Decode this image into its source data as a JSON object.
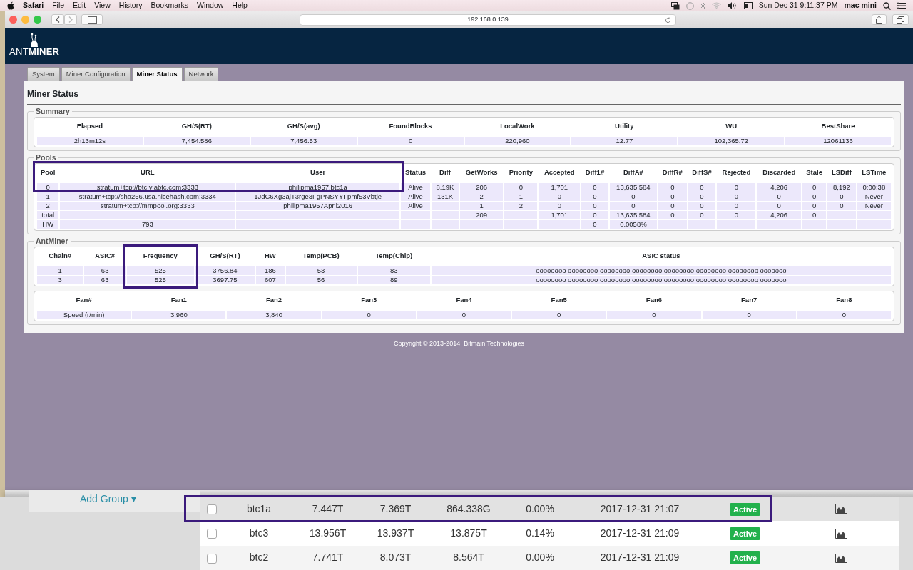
{
  "menu_bar": {
    "app": "Safari",
    "menus": [
      "File",
      "Edit",
      "View",
      "History",
      "Bookmarks",
      "Window",
      "Help"
    ],
    "clock": "Sun Dec 31  9:11:37 PM",
    "user": "mac mini"
  },
  "browser": {
    "url": "192.168.0.139"
  },
  "header": {
    "logo_light": "ANT",
    "logo_bold": "MINER"
  },
  "tabs": [
    {
      "label": "System",
      "selected": false
    },
    {
      "label": "Miner Configuration",
      "selected": false
    },
    {
      "label": "Miner Status",
      "selected": true
    },
    {
      "label": "Network",
      "selected": false
    }
  ],
  "page_title": "Miner Status",
  "summary": {
    "legend": "Summary",
    "columns": [
      "Elapsed",
      "GH/S(RT)",
      "GH/S(avg)",
      "FoundBlocks",
      "LocalWork",
      "Utility",
      "WU",
      "BestShare"
    ],
    "rows": [
      [
        "2h13m12s",
        "7,454.586",
        "7,456.53",
        "0",
        "220,960",
        "12.77",
        "102,365.72",
        "12061136"
      ]
    ]
  },
  "pools": {
    "legend": "Pools",
    "columns": [
      {
        "label": "Pool",
        "highlighted": true
      },
      {
        "label": "URL",
        "highlighted": true
      },
      {
        "label": "User",
        "highlighted": true
      },
      {
        "label": "Status",
        "highlighted": false
      },
      {
        "label": "Diff",
        "highlighted": false
      },
      {
        "label": "GetWorks",
        "highlighted": false
      },
      {
        "label": "Priority",
        "highlighted": false
      },
      {
        "label": "Accepted",
        "highlighted": false
      },
      {
        "label": "Diff1#",
        "highlighted": false
      },
      {
        "label": "DiffA#",
        "highlighted": false
      },
      {
        "label": "DiffR#",
        "highlighted": false
      },
      {
        "label": "DiffS#",
        "highlighted": false
      },
      {
        "label": "Rejected",
        "highlighted": false
      },
      {
        "label": "Discarded",
        "highlighted": false
      },
      {
        "label": "Stale",
        "highlighted": false
      },
      {
        "label": "LSDiff",
        "highlighted": false
      },
      {
        "label": "LSTime",
        "highlighted": false
      }
    ],
    "rows": [
      {
        "highlighted": true,
        "cells": [
          "0",
          "stratum+tcp://btc.viabtc.com:3333",
          "philipma1957.btc1a",
          "Alive",
          "8.19K",
          "206",
          "0",
          "1,701",
          "0",
          "13,635,584",
          "0",
          "0",
          "0",
          "4,206",
          "0",
          "8,192",
          "0:00:38"
        ]
      },
      {
        "highlighted": false,
        "cells": [
          "1",
          "stratum+tcp://sha256.usa.nicehash.com:3334",
          "1JdC6Xg3ajT3rge3FgPNSYYFpmf53Vbtje",
          "Alive",
          "131K",
          "2",
          "1",
          "0",
          "0",
          "0",
          "0",
          "0",
          "0",
          "0",
          "0",
          "0",
          "Never"
        ]
      },
      {
        "highlighted": false,
        "cells": [
          "2",
          "stratum+tcp://mmpool.org:3333",
          "philipma1957April2016",
          "Alive",
          null,
          "1",
          "2",
          "0",
          "0",
          "0",
          "0",
          "0",
          "0",
          "0",
          "0",
          "0",
          "Never"
        ]
      },
      {
        "highlighted": false,
        "cells": [
          "total",
          null,
          null,
          null,
          null,
          "209",
          null,
          "1,701",
          "0",
          "13,635,584",
          "0",
          "0",
          "0",
          "4,206",
          "0",
          null,
          null
        ]
      },
      {
        "highlighted": false,
        "cells": [
          "HW",
          "793",
          null,
          null,
          null,
          null,
          null,
          null,
          "0",
          "0.0058%",
          null,
          null,
          null,
          null,
          null,
          null,
          null
        ]
      }
    ]
  },
  "antminer": {
    "legend": "AntMiner",
    "chains": {
      "columns": [
        {
          "label": "Chain#",
          "highlighted": false
        },
        {
          "label": "ASIC#",
          "highlighted": false
        },
        {
          "label": "Frequency",
          "highlighted": true
        },
        {
          "label": "GH/S(RT)",
          "highlighted": false
        },
        {
          "label": "HW",
          "highlighted": false
        },
        {
          "label": "Temp(PCB)",
          "highlighted": false
        },
        {
          "label": "Temp(Chip)",
          "highlighted": false
        },
        {
          "label": "ASIC status",
          "highlighted": false
        }
      ],
      "rows": [
        {
          "highlighted": false,
          "cells": [
            "1",
            "63",
            "525",
            "3756.84",
            "186",
            "53",
            "83",
            "oooooooo oooooooo oooooooo oooooooo oooooooo oooooooo oooooooo ooooooo"
          ]
        },
        {
          "highlighted": false,
          "cells": [
            "3",
            "63",
            "525",
            "3697.75",
            "607",
            "56",
            "89",
            "oooooooo oooooooo oooooooo oooooooo oooooooo oooooooo oooooooo ooooooo"
          ]
        }
      ]
    },
    "fans": {
      "columns": [
        "Fan#",
        "Fan1",
        "Fan2",
        "Fan3",
        "Fan4",
        "Fan5",
        "Fan6",
        "Fan7",
        "Fan8"
      ],
      "rows": [
        [
          "Speed (r/min)",
          "3,960",
          "3,840",
          "0",
          "0",
          "0",
          "0",
          "0",
          "0"
        ]
      ]
    }
  },
  "copyright": "Copyright © 2013-2014, Bitmain Technologies",
  "background_page": {
    "link": "Add Group ▾",
    "rows": [
      {
        "checked": false,
        "highlighted": true,
        "cells": [
          "btc1a",
          "7.447T",
          "7.369T",
          "864.338G",
          "0.00%",
          "2017-12-31 21:07"
        ],
        "status": "Active"
      },
      {
        "checked": false,
        "highlighted": false,
        "cells": [
          "btc3",
          "13.956T",
          "13.937T",
          "13.875T",
          "0.14%",
          "2017-12-31 21:09"
        ],
        "status": "Active"
      },
      {
        "checked": false,
        "highlighted": false,
        "cells": [
          "btc2",
          "7.741T",
          "8.073T",
          "8.564T",
          "0.00%",
          "2017-12-31 21:09"
        ],
        "status": "Active"
      }
    ]
  }
}
